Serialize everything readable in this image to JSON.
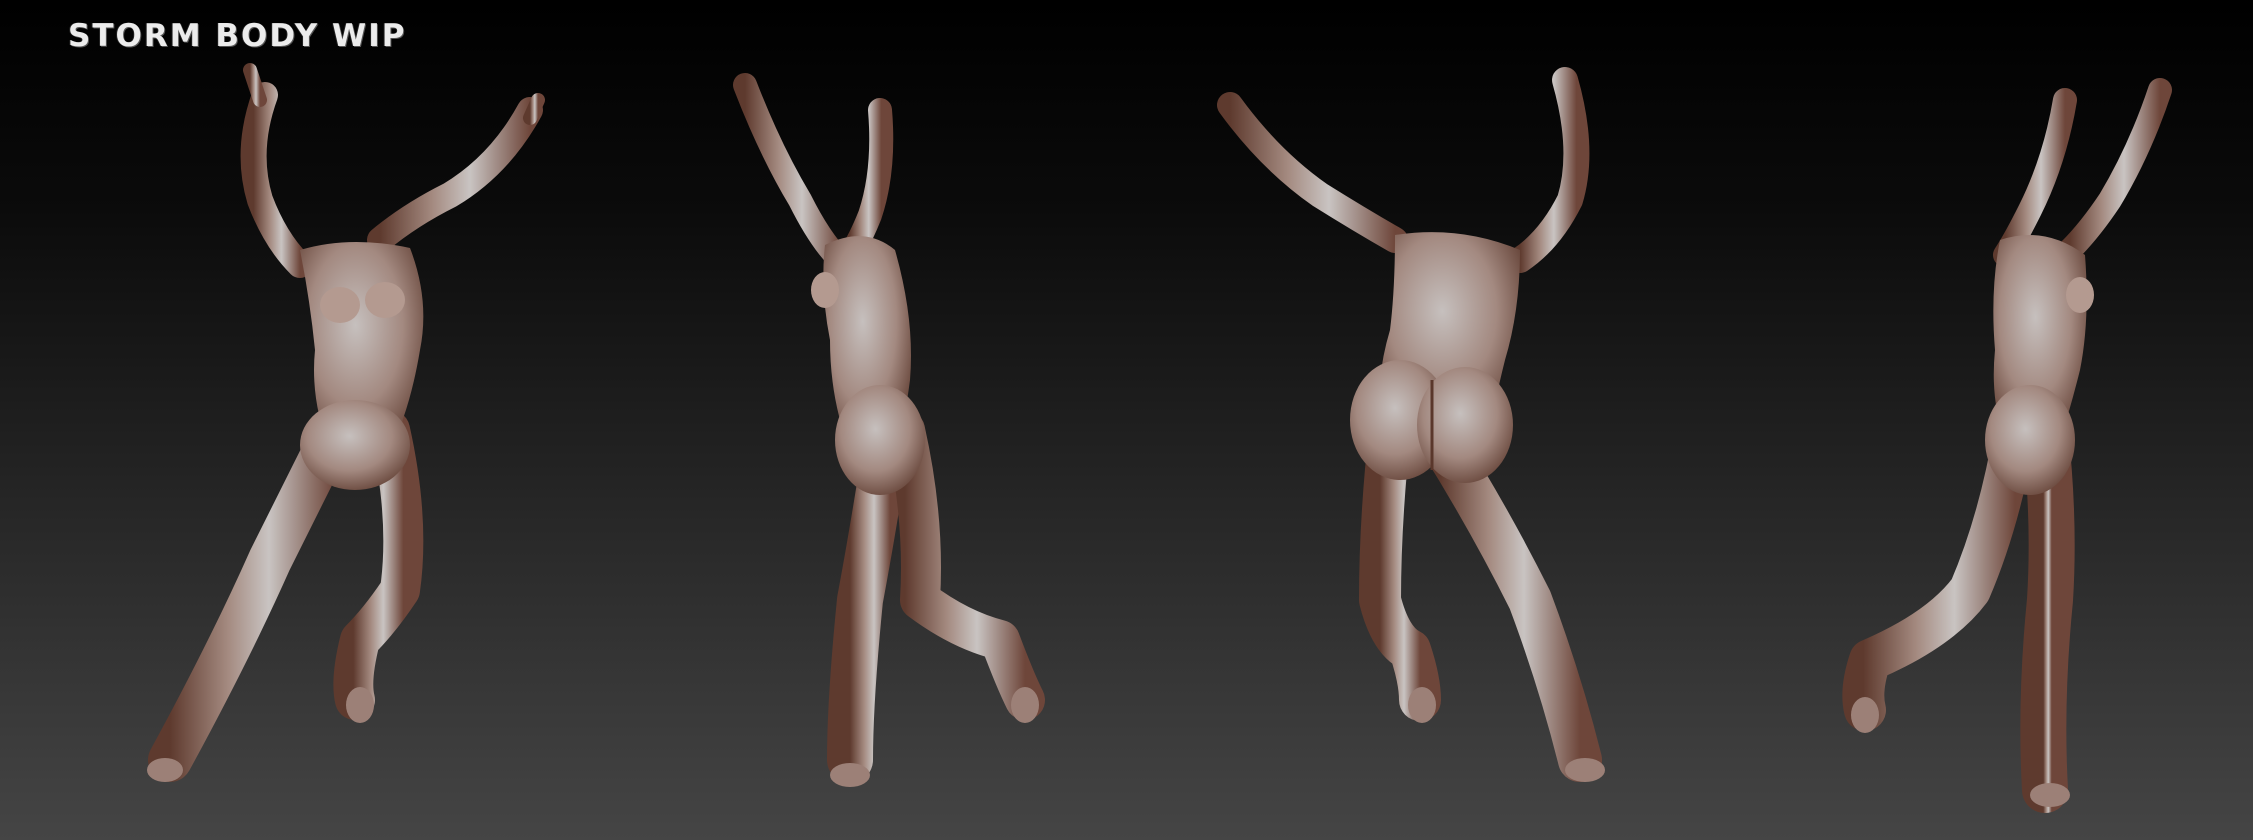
{
  "title": "STORM BODY WIP",
  "background": {
    "top_color": "#000000",
    "bottom_color": "#454545"
  },
  "skin_colors": {
    "highlight": "#c9c4c2",
    "mid": "#a48a80",
    "shadow": "#5e3a2e"
  },
  "views": [
    {
      "name": "front-view"
    },
    {
      "name": "side-view-left"
    },
    {
      "name": "back-view"
    },
    {
      "name": "side-view-right"
    }
  ]
}
